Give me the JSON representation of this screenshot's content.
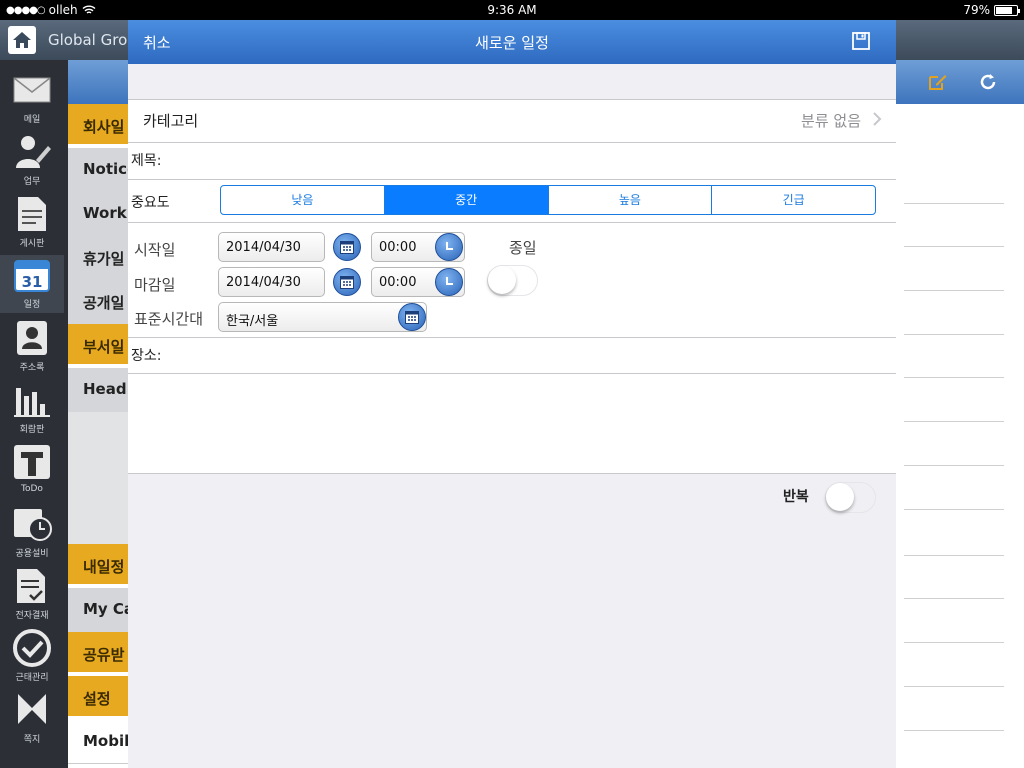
{
  "status": {
    "carrier": "olleh",
    "time": "9:36 AM",
    "battery": "79%",
    "battery_level": 0.79
  },
  "background": {
    "title": "Global Grou",
    "sidebar": [
      {
        "label": "메일",
        "icon": "mail-icon"
      },
      {
        "label": "업무",
        "icon": "task-icon"
      },
      {
        "label": "게시판",
        "icon": "board-icon"
      },
      {
        "label": "일정",
        "icon": "calendar-icon",
        "number": "31"
      },
      {
        "label": "주소록",
        "icon": "contacts-icon"
      },
      {
        "label": "회람판",
        "icon": "chart-icon"
      },
      {
        "label": "ToDo",
        "icon": "todo-icon"
      },
      {
        "label": "공용설비",
        "icon": "facility-icon"
      },
      {
        "label": "전자결재",
        "icon": "approval-icon"
      },
      {
        "label": "근태관리",
        "icon": "attendance-icon"
      },
      {
        "label": "쪽지",
        "icon": "memo-icon"
      }
    ],
    "list": [
      {
        "text": "회사일",
        "style": "yellow"
      },
      {
        "text": "Notice",
        "style": "gray"
      },
      {
        "text": "Work",
        "style": "gray"
      },
      {
        "text": "휴가일",
        "style": "gray"
      },
      {
        "text": "공개일",
        "style": "gray"
      },
      {
        "text": "부서일",
        "style": "yellow"
      },
      {
        "text": "Head",
        "style": "gray"
      },
      {
        "text": "내일정",
        "style": "yellow"
      },
      {
        "text": "My Ca",
        "style": "gray"
      },
      {
        "text": "공유받",
        "style": "yellow"
      },
      {
        "text": "설정",
        "style": "yellow"
      },
      {
        "text": "Mobil",
        "style": "white"
      }
    ]
  },
  "modal": {
    "cancel_label": "취소",
    "title": "새로운 일정",
    "category_label": "카테고리",
    "category_value": "분류 없음",
    "subject_label": "제목:",
    "priority_label": "중요도",
    "priority_options": [
      "낮음",
      "중간",
      "높음",
      "긴급"
    ],
    "priority_selected": 1,
    "start_label": "시작일",
    "start_date": "2014/04/30",
    "start_time": "00:00",
    "end_label": "마감일",
    "end_date": "2014/04/30",
    "end_time": "00:00",
    "allday_label": "종일",
    "allday_on": false,
    "timezone_label": "표준시간대",
    "timezone_value": "한국/서울",
    "location_label": "장소:",
    "repeat_label": "반복",
    "repeat_on": false
  }
}
